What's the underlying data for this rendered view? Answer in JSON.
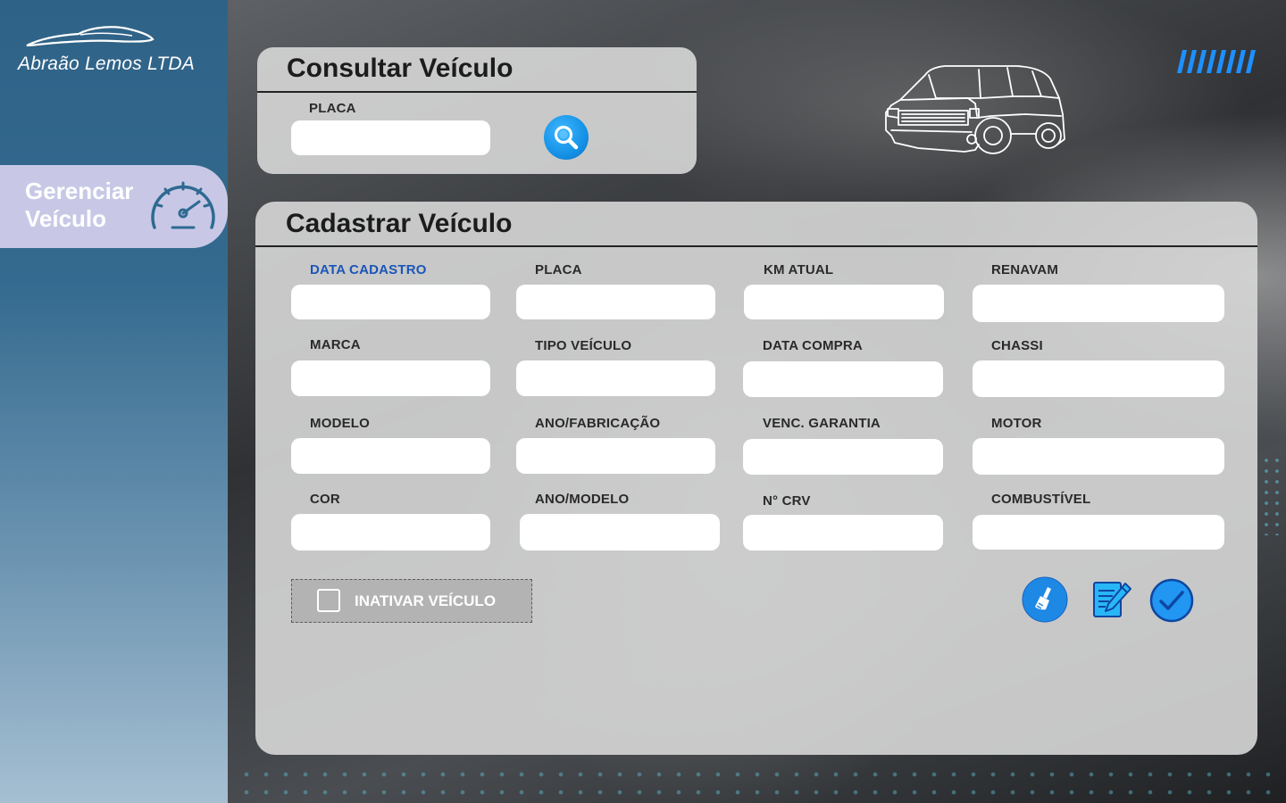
{
  "sidebar": {
    "brand": "Abraão Lemos LTDA",
    "nav_items": [
      {
        "label_line1": "Gerenciar",
        "label_line2": "Veículo",
        "icon": "speedometer-icon"
      }
    ]
  },
  "search_panel": {
    "title": "Consultar Veículo",
    "plate_label": "PLACA",
    "plate_value": "",
    "search_button_icon": "search-icon"
  },
  "register_panel": {
    "title": "Cadastrar Veículo",
    "fields": {
      "data_cadastro": {
        "label": "DATA CADASTRO",
        "value": ""
      },
      "placa": {
        "label": "PLACA",
        "value": ""
      },
      "km_atual": {
        "label": "KM ATUAL",
        "value": ""
      },
      "renavam": {
        "label": "RENAVAM",
        "value": ""
      },
      "marca": {
        "label": "MARCA",
        "value": ""
      },
      "tipo_veiculo": {
        "label": "TIPO VEÍCULO",
        "value": ""
      },
      "data_compra": {
        "label": "DATA COMPRA",
        "value": ""
      },
      "chassi": {
        "label": "CHASSI",
        "value": ""
      },
      "modelo": {
        "label": "MODELO",
        "value": ""
      },
      "ano_fabricacao": {
        "label": "ANO/FABRICAÇÃO",
        "value": ""
      },
      "venc_garantia": {
        "label": "VENC. GARANTIA",
        "value": ""
      },
      "motor": {
        "label": "MOTOR",
        "value": ""
      },
      "cor": {
        "label": "COR",
        "value": ""
      },
      "ano_modelo": {
        "label": "ANO/MODELO",
        "value": ""
      },
      "n_crv": {
        "label": "N° CRV",
        "value": ""
      },
      "combustivel": {
        "label": "COMBUSTÍVEL",
        "value": ""
      }
    },
    "inactivate": {
      "label": "INATIVAR VEÍCULO",
      "checked": false
    },
    "actions": [
      "clear-icon",
      "edit-icon",
      "confirm-icon"
    ]
  },
  "colors": {
    "accent_label": "#1a56b8",
    "action_blue": "#1e88e5",
    "sidebar_top": "#2f6287",
    "nav_active": "#c8c8e6"
  }
}
